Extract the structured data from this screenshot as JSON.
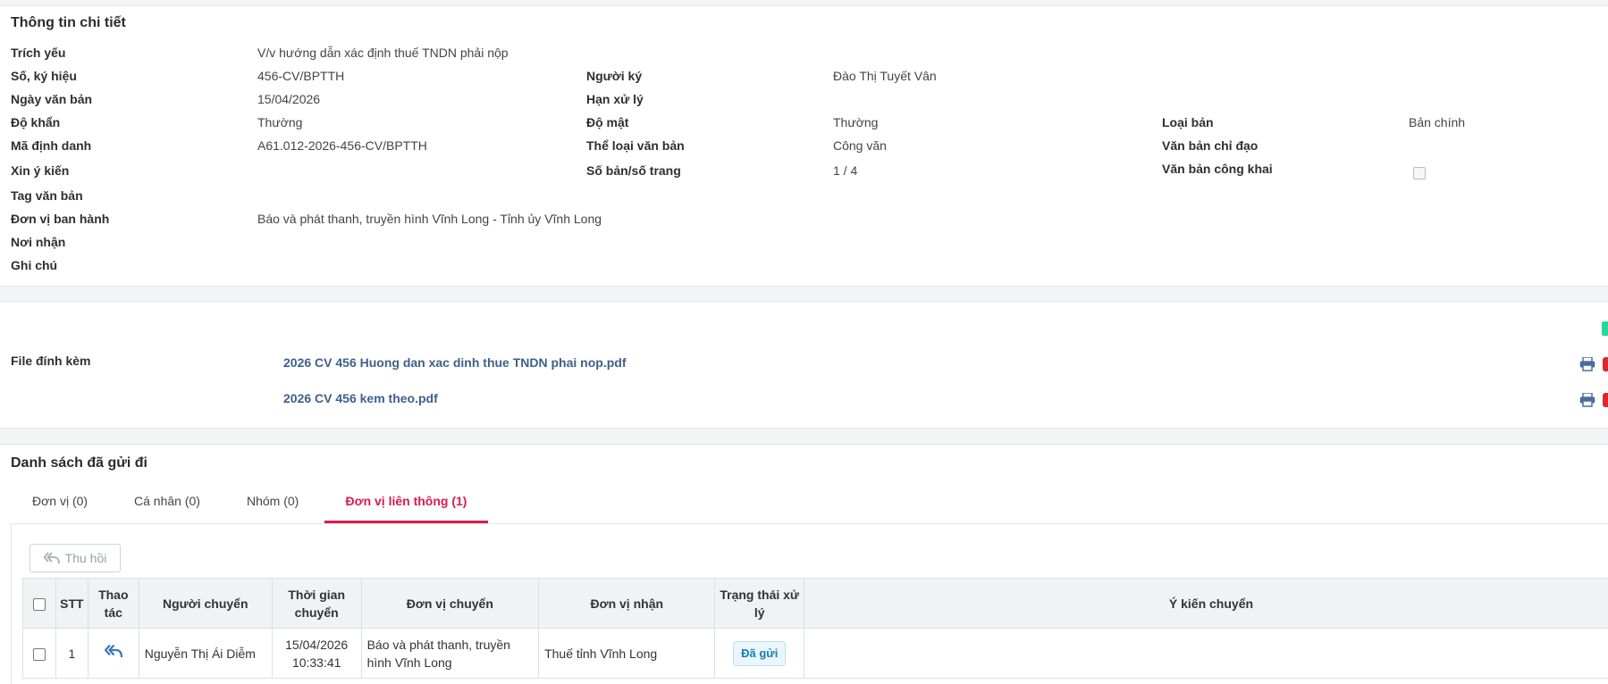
{
  "detail": {
    "title": "Thông tin chi tiết",
    "trich_yeu": {
      "label": "Trích yếu",
      "value": "V/v hướng dẫn xác định thuế TNDN phải nộp"
    },
    "so_ky_hieu": {
      "label": "Số, ký hiệu",
      "value": "456-CV/BPTTH"
    },
    "nguoi_ky": {
      "label": "Người ký",
      "value": "Đào Thị Tuyết Vân"
    },
    "ngay_van_ban": {
      "label": "Ngày văn bản",
      "value": "15/04/2026"
    },
    "han_xu_ly": {
      "label": "Hạn xử lý",
      "value": ""
    },
    "do_khan": {
      "label": "Độ khẩn",
      "value": "Thường"
    },
    "do_mat": {
      "label": "Độ mật",
      "value": "Thường"
    },
    "loai_ban": {
      "label": "Loại bản",
      "value": "Bản chính"
    },
    "ma_dinh_danh": {
      "label": "Mã định danh",
      "value": "A61.012-2026-456-CV/BPTTH"
    },
    "the_loai": {
      "label": "Thể loại văn bản",
      "value": "Công văn"
    },
    "chi_dao": {
      "label": "Văn bản chỉ đạo",
      "value": ""
    },
    "xin_y_kien": {
      "label": "Xin ý kiến",
      "value": ""
    },
    "so_ban_trang": {
      "label": "Số bản/số trang",
      "value": "1 / 4"
    },
    "cong_khai": {
      "label": "Văn bản công khai",
      "checked": false
    },
    "tag": {
      "label": "Tag văn bản",
      "value": ""
    },
    "don_vi_ban_hanh": {
      "label": "Đơn vị ban hành",
      "value": "Báo và phát thanh, truyền hình Vĩnh Long - Tỉnh ủy Vĩnh Long"
    },
    "noi_nhan": {
      "label": "Nơi nhận",
      "value": ""
    },
    "ghi_chu": {
      "label": "Ghi chú",
      "value": ""
    }
  },
  "files": {
    "label": "File đính kèm",
    "items": [
      {
        "name": "2026 CV 456 Huong dan xac dinh thue TNDN phai nop.pdf"
      },
      {
        "name": "2026 CV 456 kem theo.pdf"
      }
    ],
    "print_icon": "printer-icon",
    "accent_green": "#28d79a",
    "accent_red": "#d62b2b"
  },
  "sent": {
    "title": "Danh sách đã gửi đi",
    "tabs": [
      {
        "label": "Đơn vị (0)",
        "active": false
      },
      {
        "label": "Cá nhân (0)",
        "active": false
      },
      {
        "label": "Nhóm (0)",
        "active": false
      },
      {
        "label": "Đơn vị liên thông (1)",
        "active": true
      }
    ],
    "active_color": "#d81b4c",
    "recall_button": "Thu hồi",
    "columns": {
      "stt": "STT",
      "thao_tac": "Thao tác",
      "nguoi_chuyen": "Người chuyển",
      "thoi_gian": "Thời gian chuyển",
      "don_vi_chuyen": "Đơn vị chuyển",
      "don_vi_nhan": "Đơn vị nhận",
      "trang_thai": "Trạng thái xử lý",
      "y_kien": "Ý kiến chuyển"
    },
    "rows": [
      {
        "stt": "1",
        "action_icon": "reply-icon",
        "nguoi_chuyen": "Nguyễn Thị Ái Diễm",
        "thoi_gian_date": "15/04/2026",
        "thoi_gian_time": "10:33:41",
        "don_vi_chuyen": "Báo và phát thanh, truyền hình Vĩnh Long",
        "don_vi_nhan": "Thuế tỉnh Vĩnh Long",
        "trang_thai": "Đã gửi",
        "y_kien": ""
      }
    ]
  }
}
